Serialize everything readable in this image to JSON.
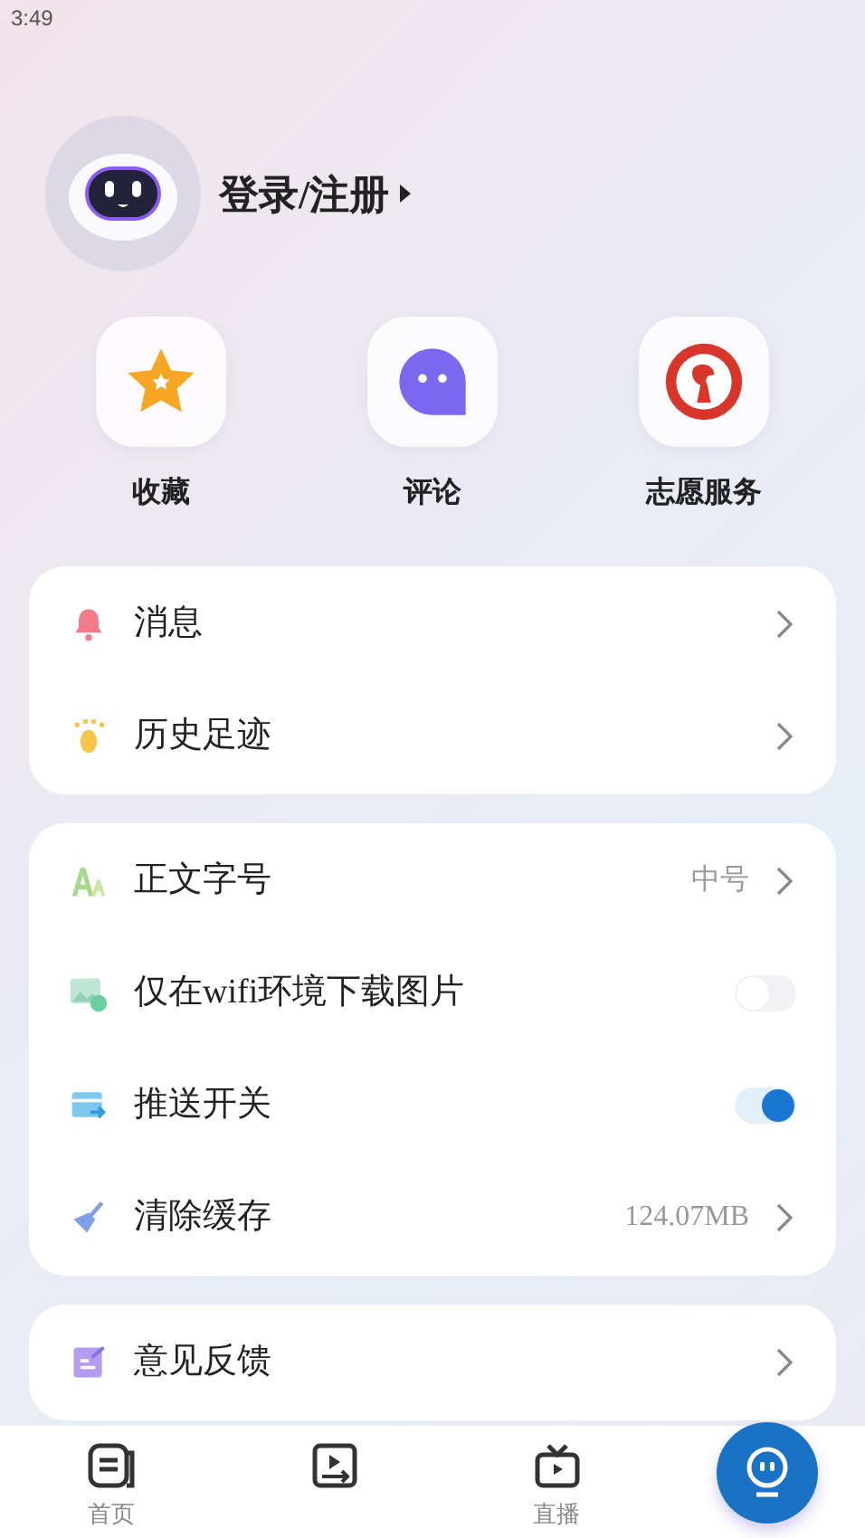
{
  "status_bar": {
    "time": "3:49"
  },
  "profile": {
    "login_label": "登录/注册"
  },
  "shortcuts": [
    {
      "kind": "star",
      "label": "收藏"
    },
    {
      "kind": "chat",
      "label": "评论"
    },
    {
      "kind": "emblem",
      "label": "志愿服务"
    }
  ],
  "groups": [
    {
      "rows": [
        {
          "kind": "link",
          "label": "消息"
        },
        {
          "kind": "link",
          "label": "历史足迹"
        }
      ]
    },
    {
      "rows": [
        {
          "kind": "link",
          "label": "正文字号",
          "value": "中号"
        },
        {
          "kind": "toggle",
          "label": "仅在wifi环境下载图片",
          "on": false
        },
        {
          "kind": "toggle",
          "label": "推送开关",
          "on": true
        },
        {
          "kind": "link",
          "label": "清除缓存",
          "value": "124.07MB"
        }
      ]
    },
    {
      "rows": [
        {
          "kind": "link",
          "label": "意见反馈"
        }
      ]
    }
  ],
  "bottom_nav": [
    {
      "kind": "tab",
      "label": "首页"
    },
    {
      "kind": "tab"
    },
    {
      "kind": "tab",
      "label": "直播"
    },
    {
      "kind": "fab"
    }
  ]
}
